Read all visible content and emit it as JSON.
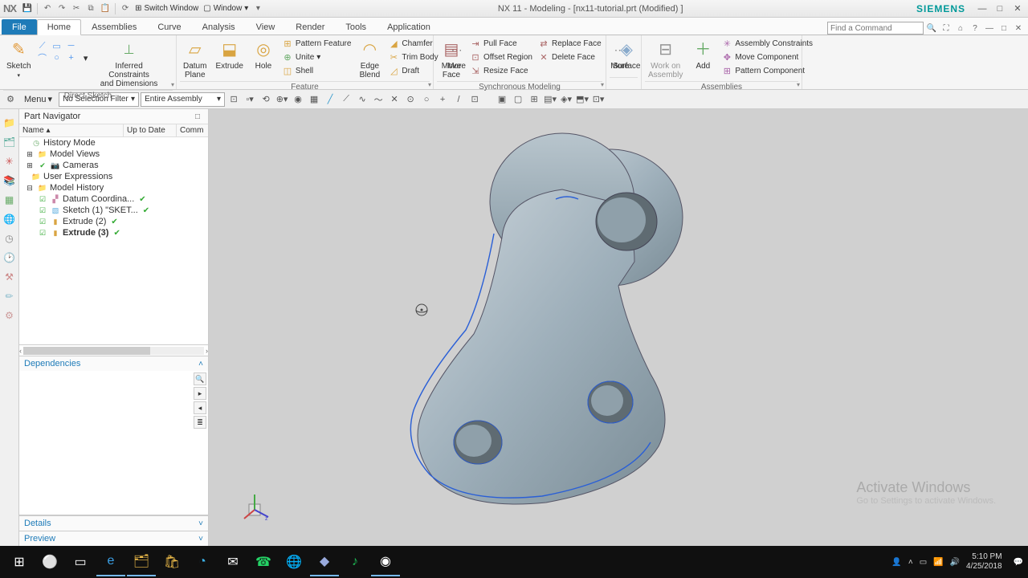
{
  "title": "NX 11 - Modeling - [nx11-tutorial.prt (Modified) ]",
  "brand": "SIEMENS",
  "nx_logo": "NX",
  "qat": {
    "switch_window": "Switch Window",
    "window": "Window"
  },
  "tabs": {
    "file": "File",
    "home": "Home",
    "assemblies": "Assemblies",
    "curve": "Curve",
    "analysis": "Analysis",
    "view": "View",
    "render": "Render",
    "tools": "Tools",
    "application": "Application"
  },
  "find_placeholder": "Find a Command",
  "ribbon": {
    "direct_sketch": {
      "label": "Direct Sketch",
      "sketch": "Sketch",
      "inferred": "Inferred Constraints\nand Dimensions"
    },
    "feature": {
      "label": "Feature",
      "datum": "Datum\nPlane",
      "extrude": "Extrude",
      "hole": "Hole",
      "pattern": "Pattern Feature",
      "unite": "Unite",
      "shell": "Shell",
      "edge_blend": "Edge\nBlend",
      "chamfer": "Chamfer",
      "trim": "Trim Body",
      "draft": "Draft",
      "more": "More"
    },
    "sync": {
      "label": "Synchronous Modeling",
      "move_face": "Move\nFace",
      "pull": "Pull Face",
      "offset": "Offset Region",
      "resize": "Resize Face",
      "replace": "Replace Face",
      "delete": "Delete Face",
      "more": "More"
    },
    "surface": {
      "surface": "Surface"
    },
    "assemblies": {
      "label": "Assemblies",
      "work": "Work on\nAssembly",
      "add": "Add",
      "constraints": "Assembly Constraints",
      "movec": "Move Component",
      "patternc": "Pattern Component"
    }
  },
  "selbar": {
    "menu": "Menu",
    "filter": "No Selection Filter",
    "scope": "Entire Assembly"
  },
  "nav": {
    "title": "Part Navigator",
    "cols": {
      "name": "Name",
      "uptodate": "Up to Date",
      "comm": "Comm"
    },
    "history_mode": "History Mode",
    "model_views": "Model Views",
    "cameras": "Cameras",
    "user_expr": "User Expressions",
    "model_history": "Model History",
    "items": {
      "datum": "Datum Coordina...",
      "sketch1": "Sketch (1) \"SKET...",
      "extrude2": "Extrude (2)",
      "extrude3": "Extrude (3)"
    },
    "deps": "Dependencies",
    "details": "Details",
    "preview": "Preview"
  },
  "watermark": {
    "t1": "Activate Windows",
    "t2": "Go to Settings to activate Windows."
  },
  "clock": {
    "time": "5:10 PM",
    "date": "4/25/2018"
  }
}
